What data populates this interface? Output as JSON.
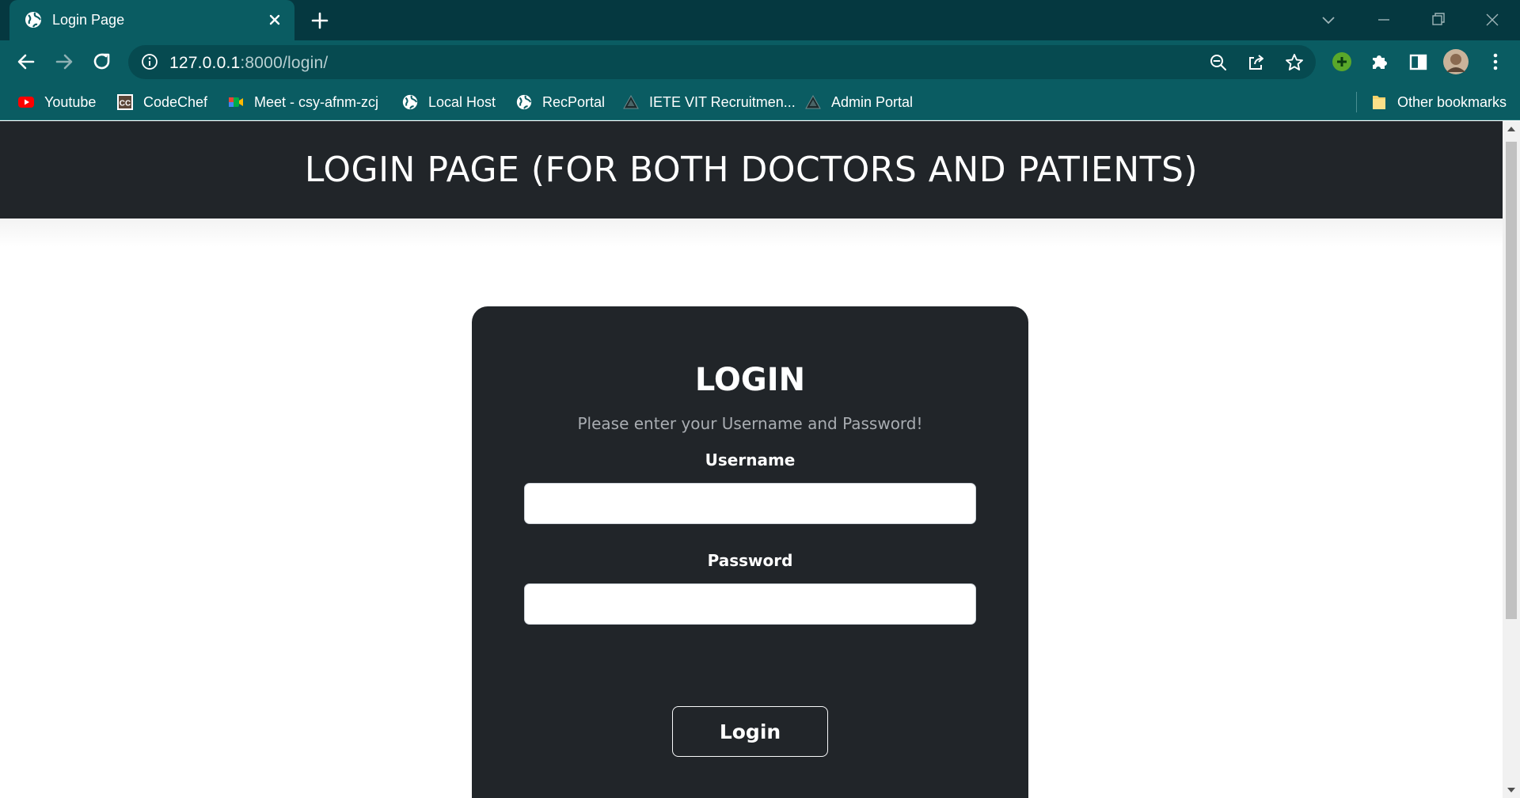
{
  "tab": {
    "title": "Login Page",
    "favicon": "globe-icon",
    "close": "close-icon"
  },
  "window": {
    "new_tab": "plus-icon",
    "controls": [
      "tab-search-icon",
      "minimize-icon",
      "restore-icon",
      "close-window-icon"
    ]
  },
  "toolbar": {
    "url_host": "127.0.0.1",
    "url_rest": ":8000/login/",
    "icons": [
      "back-icon",
      "forward-icon",
      "reload-icon",
      "site-info-icon",
      "zoom-out-icon",
      "share-icon",
      "bookmark-star-icon",
      "extension-green-icon",
      "extensions-puzzle-icon",
      "side-panel-icon",
      "profile-avatar",
      "menu-kebab-icon"
    ]
  },
  "bookmarks": {
    "items": [
      {
        "label": "Youtube",
        "icon": "youtube-icon"
      },
      {
        "label": "CodeChef",
        "icon": "codechef-icon"
      },
      {
        "label": "Meet - csy-afnm-zcj",
        "icon": "google-meet-icon"
      },
      {
        "label": "Local Host",
        "icon": "globe-icon"
      },
      {
        "label": "RecPortal",
        "icon": "globe-icon"
      },
      {
        "label": "IETE VIT Recruitmen...",
        "icon": "iete-logo-icon"
      },
      {
        "label": "Admin Portal",
        "icon": "iete-logo-icon"
      }
    ],
    "other": {
      "label": "Other bookmarks",
      "icon": "folder-icon"
    }
  },
  "page": {
    "header_title": "LOGIN PAGE (FOR BOTH DOCTORS AND PATIENTS)",
    "card_title": "LOGIN",
    "card_subtitle": "Please enter your Username and Password!",
    "username_label": "Username",
    "username_value": "",
    "password_label": "Password",
    "password_value": "",
    "login_button": "Login"
  },
  "colors": {
    "chrome_dark": "#053840",
    "chrome_teal": "#0a5c62",
    "page_dark": "#212529"
  }
}
